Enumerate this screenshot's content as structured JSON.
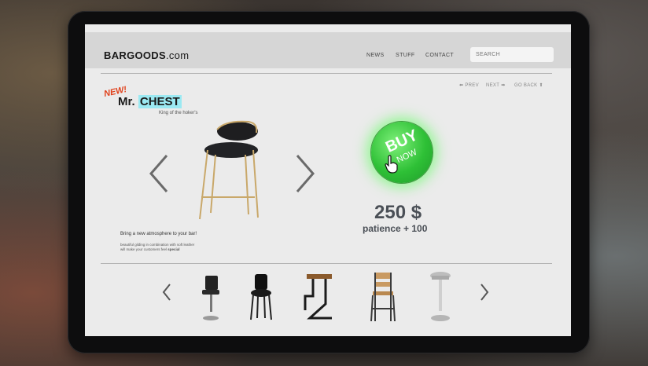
{
  "site": {
    "brand_bold": "BARGOODS",
    "brand_light": ".com"
  },
  "nav": {
    "news": "NEWS",
    "stuff": "STUFF",
    "contact": "CONTACT"
  },
  "search": {
    "placeholder": "SEARCH"
  },
  "pager": {
    "prev": "PREV",
    "next": "NEXT",
    "goback": "GO BACK"
  },
  "product": {
    "badge": "NEW!",
    "title_prefix": "Mr.",
    "title_name": "CHEST",
    "tagline": "King of the hoker's",
    "description": "Bring a new atmosphere to your bar!",
    "details_line1": "beautiful gilding in combination with soft leather",
    "details_line2": "will make your customers feel",
    "details_emph": "special",
    "price": "250 $",
    "bonus": "patience + 100"
  },
  "buy_button": {
    "line1": "BUY",
    "line2": "NOW"
  },
  "carousel_thumbnails": [
    "black-swivel-bar-stool-icon",
    "black-padded-bar-stool-icon",
    "wood-metal-z-stool-icon",
    "wood-ladder-back-stool-icon",
    "chrome-saddle-stool-icon"
  ],
  "colors": {
    "highlight": "#9be9f2",
    "buy_green": "#2ec036",
    "badge_red": "#e0401a",
    "price": "#4a4f56"
  }
}
